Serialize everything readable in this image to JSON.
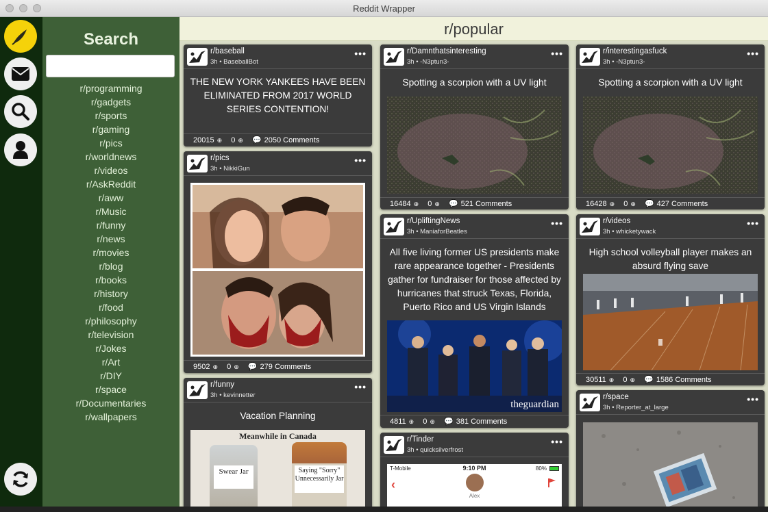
{
  "window": {
    "title": "Reddit Wrapper"
  },
  "rail": {
    "icons": [
      "logo-icon",
      "mail-icon",
      "search-icon",
      "user-icon",
      "refresh-icon"
    ]
  },
  "sidebar": {
    "title": "Search",
    "search_value": "",
    "items": [
      "r/programming",
      "r/gadgets",
      "r/sports",
      "r/gaming",
      "r/pics",
      "r/worldnews",
      "r/videos",
      "r/AskReddit",
      "r/aww",
      "r/Music",
      "r/funny",
      "r/news",
      "r/movies",
      "r/blog",
      "r/books",
      "r/history",
      "r/food",
      "r/philosophy",
      "r/television",
      "r/Jokes",
      "r/Art",
      "r/DIY",
      "r/space",
      "r/Documentaries",
      "r/wallpapers"
    ]
  },
  "header": {
    "title": "r/popular"
  },
  "more_label": "•••",
  "posts": [
    {
      "subreddit": "r/baseball",
      "meta": "3h • BaseballBot",
      "title": "THE NEW YORK YANKEES HAVE BEEN ELIMINATED FROM 2017 WORLD SERIES CONTENTION!",
      "upvotes": "20015",
      "downvotes": "0",
      "comments": "2050 Comments"
    },
    {
      "subreddit": "r/pics",
      "meta": "3h • NikkiGun",
      "title": "",
      "upvotes": "9502",
      "downvotes": "0",
      "comments": "279 Comments"
    },
    {
      "subreddit": "r/funny",
      "meta": "3h • kevinnetter",
      "title": "Vacation Planning",
      "image_caption": "Meanwhile in Canada",
      "jar1": "Swear Jar",
      "jar2": "Saying \"Sorry\" Unnecessarily Jar"
    },
    {
      "subreddit": "r/Damnthatsinteresting",
      "meta": "3h • -N3ptun3-",
      "title": "Spotting a scorpion with a UV light",
      "upvotes": "16484",
      "downvotes": "0",
      "comments": "521 Comments"
    },
    {
      "subreddit": "r/UpliftingNews",
      "meta": "3h • ManiaforBeatles",
      "title": "All five living former US presidents make rare appearance together - Presidents gather for fundraiser for those affected by hurricanes that struck Texas, Florida, Puerto Rico and US Virgin Islands",
      "image_watermark": "theguardian",
      "upvotes": "4811",
      "downvotes": "0",
      "comments": "381 Comments"
    },
    {
      "subreddit": "r/Tinder",
      "meta": "3h • quicksilverfrost",
      "status_carrier": "T-Mobile",
      "status_time": "9:10 PM",
      "status_battery": "80%",
      "profile_name": "Alex"
    },
    {
      "subreddit": "r/interestingasfuck",
      "meta": "3h • -N3ptun3-",
      "title": "Spotting a scorpion with a UV light",
      "upvotes": "16428",
      "downvotes": "0",
      "comments": "427 Comments"
    },
    {
      "subreddit": "r/videos",
      "meta": "3h • whicketywack",
      "title": "High school volleyball player makes an absurd flying save",
      "upvotes": "30511",
      "downvotes": "0",
      "comments": "1586 Comments"
    },
    {
      "subreddit": "r/space",
      "meta": "3h • Reporter_at_large"
    }
  ]
}
